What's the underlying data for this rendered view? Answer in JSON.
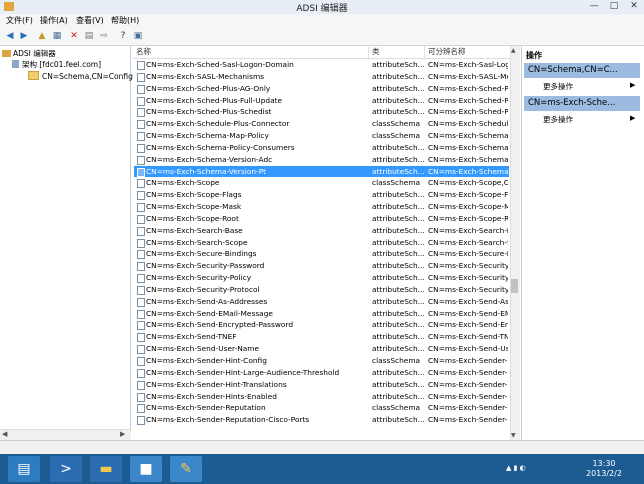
{
  "window": {
    "title": "ADSI 编辑器"
  },
  "menu": [
    "文件(F)",
    "操作(A)",
    "查看(V)",
    "帮助(H)"
  ],
  "tree": {
    "root": "ADSI 编辑器",
    "child": "架构 [fdc01.feel.com]",
    "grandchild": "CN=Schema,CN=Configu"
  },
  "list": {
    "headers": [
      "名称",
      "类",
      "可分辨名称"
    ],
    "selected_index": 9,
    "rows": [
      [
        "CN=ms-Exch-Sched-Sasl-Logon-Domain",
        "attributeSch...",
        "CN=ms-Exch-Sasl-Logo"
      ],
      [
        "CN=ms-Exch-SASL-Mechanisms",
        "attributeSch...",
        "CN=ms-Exch-SASL-Me"
      ],
      [
        "CN=ms-Exch-Sched-Plus-AG-Only",
        "attributeSch...",
        "CN=ms-Exch-Sched-P"
      ],
      [
        "CN=ms-Exch-Sched-Plus-Full-Update",
        "attributeSch...",
        "CN=ms-Exch-Sched-P"
      ],
      [
        "CN=ms-Exch-Sched-Plus-Schedist",
        "attributeSch...",
        "CN=ms-Exch-Sched-P"
      ],
      [
        "CN=ms-Exch-Schedule-Plus-Connector",
        "classSchema",
        "CN=ms-Exch-Schedule"
      ],
      [
        "CN=ms-Exch-Schema-Map-Policy",
        "classSchema",
        "CN=ms-Exch-Schema-"
      ],
      [
        "CN=ms-Exch-Schema-Policy-Consumers",
        "attributeSch...",
        "CN=ms-Exch-Schema-"
      ],
      [
        "CN=ms-Exch-Schema-Version-Adc",
        "attributeSch...",
        "CN=ms-Exch-Schema-"
      ],
      [
        "CN=ms-Exch-Schema-Version-Pt",
        "attributeSch...",
        "CN=ms-Exch-Schema-"
      ],
      [
        "CN=ms-Exch-Scope",
        "classSchema",
        "CN=ms-Exch-Scope,C"
      ],
      [
        "CN=ms-Exch-Scope-Flags",
        "attributeSch...",
        "CN=ms-Exch-Scope-F"
      ],
      [
        "CN=ms-Exch-Scope-Mask",
        "attributeSch...",
        "CN=ms-Exch-Scope-M"
      ],
      [
        "CN=ms-Exch-Scope-Root",
        "attributeSch...",
        "CN=ms-Exch-Scope-R"
      ],
      [
        "CN=ms-Exch-Search-Base",
        "attributeSch...",
        "CN=ms-Exch-Search-B"
      ],
      [
        "CN=ms-Exch-Search-Scope",
        "attributeSch...",
        "CN=ms-Exch-Search-S"
      ],
      [
        "CN=ms-Exch-Secure-Bindings",
        "attributeSch...",
        "CN=ms-Exch-Secure-B"
      ],
      [
        "CN=ms-Exch-Security-Password",
        "attributeSch...",
        "CN=ms-Exch-Security-"
      ],
      [
        "CN=ms-Exch-Security-Policy",
        "attributeSch...",
        "CN=ms-Exch-Security-"
      ],
      [
        "CN=ms-Exch-Security-Protocol",
        "attributeSch...",
        "CN=ms-Exch-Security-"
      ],
      [
        "CN=ms-Exch-Send-As-Addresses",
        "attributeSch...",
        "CN=ms-Exch-Send-As-"
      ],
      [
        "CN=ms-Exch-Send-EMail-Message",
        "attributeSch...",
        "CN=ms-Exch-Send-EM"
      ],
      [
        "CN=ms-Exch-Send-Encrypted-Password",
        "attributeSch...",
        "CN=ms-Exch-Send-En"
      ],
      [
        "CN=ms-Exch-Send-TNEF",
        "attributeSch...",
        "CN=ms-Exch-Send-TN"
      ],
      [
        "CN=ms-Exch-Send-User-Name",
        "attributeSch...",
        "CN=ms-Exch-Send-Us"
      ],
      [
        "CN=ms-Exch-Sender-Hint-Config",
        "classSchema",
        "CN=ms-Exch-Sender-H"
      ],
      [
        "CN=ms-Exch-Sender-Hint-Large-Audience-Threshold",
        "attributeSch...",
        "CN=ms-Exch-Sender-H"
      ],
      [
        "CN=ms-Exch-Sender-Hint-Translations",
        "attributeSch...",
        "CN=ms-Exch-Sender-H"
      ],
      [
        "CN=ms-Exch-Sender-Hints-Enabled",
        "attributeSch...",
        "CN=ms-Exch-Sender-H"
      ],
      [
        "CN=ms-Exch-Sender-Reputation",
        "classSchema",
        "CN=ms-Exch-Sender-R"
      ],
      [
        "CN=ms-Exch-Sender-Reputation-Cisco-Ports",
        "attributeSch...",
        "CN=ms-Exch-Sender-R"
      ]
    ]
  },
  "actions": {
    "header": "操作",
    "section1": "CN=Schema,CN=C...",
    "section1_item": "更多操作",
    "section2": "CN=ms-Exch-Sche...",
    "section2_item": "更多操作"
  },
  "taskbar": {
    "time": "13:30",
    "date": "2013/2/2"
  },
  "colors": {
    "selection": "#3399ff",
    "taskbar": "#1d5c93",
    "action_header": "#9cbbe0"
  }
}
